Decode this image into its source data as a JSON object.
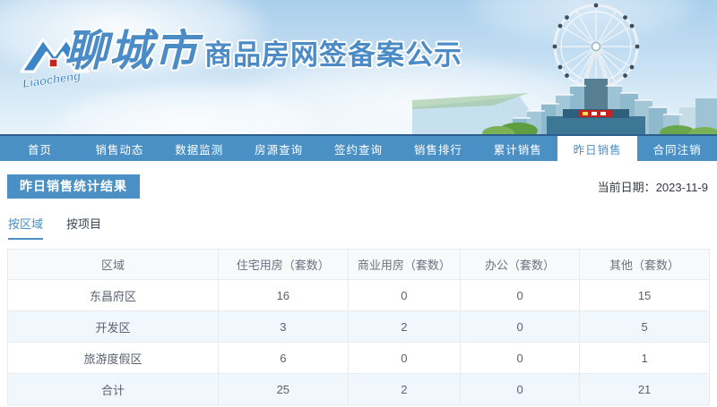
{
  "banner": {
    "logo_text": "Liaocheng",
    "site_title_prefix": "聊城市",
    "site_title": "商品房网签备案公示"
  },
  "nav": {
    "items": [
      {
        "label": "首页",
        "active": false
      },
      {
        "label": "销售动态",
        "active": false
      },
      {
        "label": "数据监测",
        "active": false
      },
      {
        "label": "房源查询",
        "active": false
      },
      {
        "label": "签约查询",
        "active": false
      },
      {
        "label": "销售排行",
        "active": false
      },
      {
        "label": "累计销售",
        "active": false
      },
      {
        "label": "昨日销售",
        "active": true
      },
      {
        "label": "合同注销",
        "active": false
      }
    ]
  },
  "page": {
    "section_title": "昨日销售统计结果",
    "date_label": "当前日期：",
    "date_value": "2023-11-9"
  },
  "tabs": [
    {
      "label": "按区域",
      "active": true
    },
    {
      "label": "按项目",
      "active": false
    }
  ],
  "table": {
    "headers": [
      "区域",
      "住宅用房（套数）",
      "商业用房（套数）",
      "办公（套数）",
      "其他（套数）"
    ],
    "rows": [
      [
        "东昌府区",
        "16",
        "0",
        "0",
        "15"
      ],
      [
        "开发区",
        "3",
        "2",
        "0",
        "5"
      ],
      [
        "旅游度假区",
        "6",
        "0",
        "0",
        "1"
      ],
      [
        "合计",
        "25",
        "2",
        "0",
        "21"
      ]
    ]
  },
  "colors": {
    "accent": "#4a90c5",
    "stripe": "#f0f7fd",
    "border": "#e8ebee",
    "header-bg": "#f8f9fa",
    "banner-title-blue": "#4c8cc6",
    "logo-red": "#c3251d"
  }
}
